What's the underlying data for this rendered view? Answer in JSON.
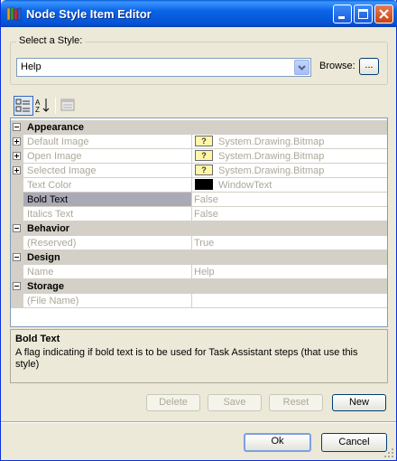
{
  "window": {
    "title": "Node Style Item Editor",
    "icon": "books-icon"
  },
  "style_group": {
    "label": "Select a Style:",
    "selected": "Help",
    "browse_label": "Browse:",
    "browse_button": "..."
  },
  "toolbar": {
    "icons": [
      "categorized-icon",
      "alphabetical-icon",
      "property-pages-icon"
    ]
  },
  "grid": {
    "categories": [
      {
        "label": "Appearance",
        "props": [
          {
            "name": "Default Image",
            "value": "System.Drawing.Bitmap",
            "swatch": "bitmap",
            "expandable": true
          },
          {
            "name": "Open Image",
            "value": "System.Drawing.Bitmap",
            "swatch": "bitmap",
            "expandable": true
          },
          {
            "name": "Selected Image",
            "value": "System.Drawing.Bitmap",
            "swatch": "bitmap",
            "expandable": true
          },
          {
            "name": "Text Color",
            "value": "WindowText",
            "swatch": "black"
          },
          {
            "name": "Bold Text",
            "value": "False",
            "selected": true
          },
          {
            "name": "Italics Text",
            "value": "False"
          }
        ]
      },
      {
        "label": "Behavior",
        "props": [
          {
            "name": "(Reserved)",
            "value": "True"
          }
        ]
      },
      {
        "label": "Design",
        "props": [
          {
            "name": "Name",
            "value": "Help"
          }
        ]
      },
      {
        "label": "Storage",
        "props": [
          {
            "name": "(File Name)",
            "value": ""
          }
        ]
      }
    ]
  },
  "description": {
    "title": "Bold Text",
    "text": "A flag indicating if bold text is to be used for Task Assistant steps (that use this style)"
  },
  "buttons": {
    "delete": "Delete",
    "save": "Save",
    "reset": "Reset",
    "new": "New",
    "ok": "Ok",
    "cancel": "Cancel"
  },
  "colors": {
    "title_bar": "#0a5fd8",
    "grid_category": "#d4d0c8",
    "selected_row": "#aaaab7",
    "disabled_text": "#aca899"
  }
}
